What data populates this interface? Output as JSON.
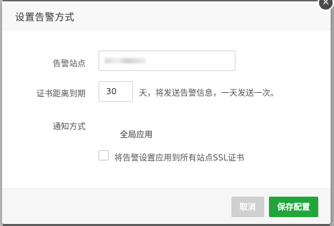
{
  "dialog": {
    "title": "设置告警方式",
    "close_glyph": "×"
  },
  "form": {
    "site_label": "告警站点",
    "site_value": "",
    "days_label": "证书距离到期",
    "days_value": "30",
    "days_hint": "天，将发送告警信息，一天发送一次。",
    "notify_label": "通知方式",
    "notify_scope": "全局应用",
    "apply_all_label": "将告警设置应用到所有站点SSL证书",
    "apply_all_checked": false
  },
  "footer": {
    "cancel_label": "取消",
    "save_label": "保存配置"
  },
  "colors": {
    "save_button": "#20a53a",
    "cancel_button": "#cfcfcf",
    "header_bg": "#f8f8f8"
  },
  "icons": {
    "close": "close-icon"
  }
}
